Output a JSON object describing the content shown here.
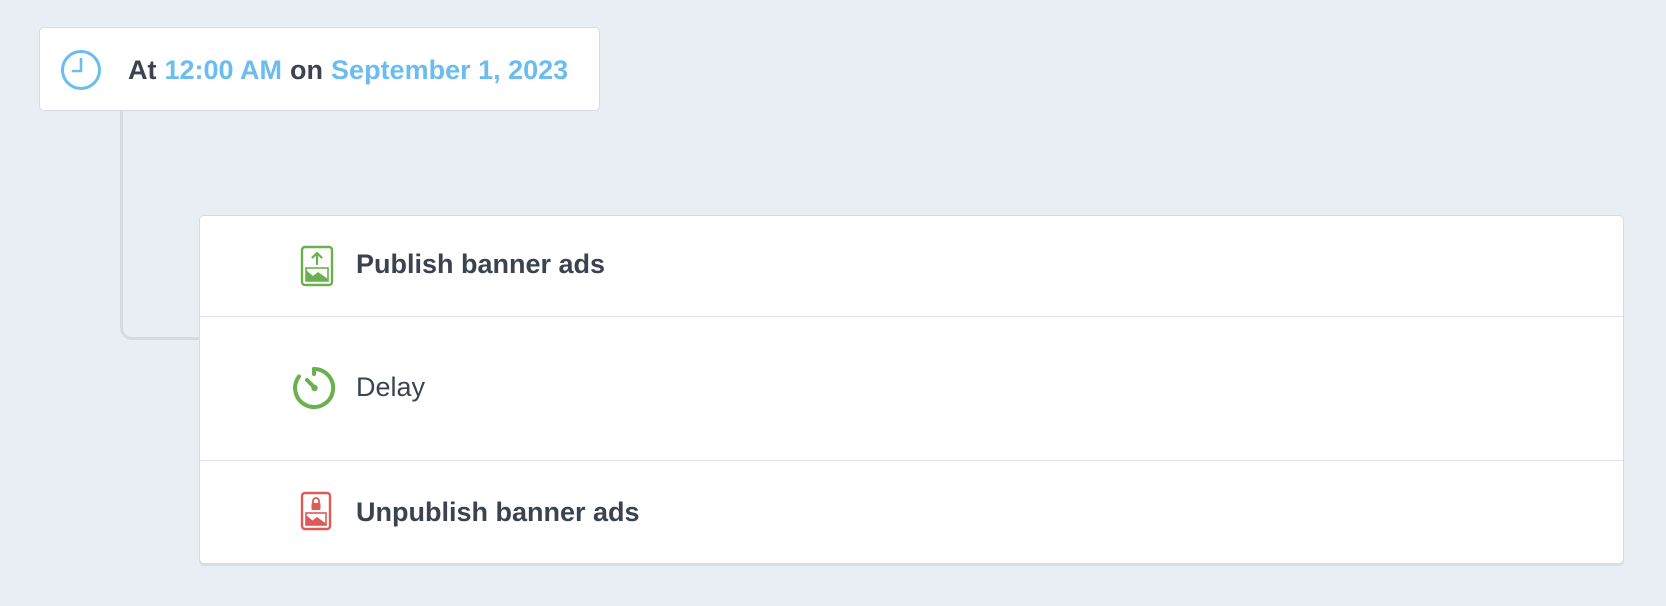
{
  "trigger": {
    "prefix": "At",
    "time": "12:00 AM",
    "middle": "on",
    "date": "September 1, 2023",
    "icon": "clock-icon"
  },
  "actions": [
    {
      "label": "Publish banner ads",
      "icon": "publish-banner-icon"
    },
    {
      "label": "Delay",
      "icon": "delay-timer-icon"
    },
    {
      "label": "Unpublish banner ads",
      "icon": "unpublish-banner-icon"
    }
  ],
  "colors": {
    "background": "#e9edf4",
    "accent_blue": "#6bbcf0",
    "green": "#6ab04c",
    "red": "#dd5a55",
    "text": "#3b4350",
    "border": "#d6dbe3"
  }
}
